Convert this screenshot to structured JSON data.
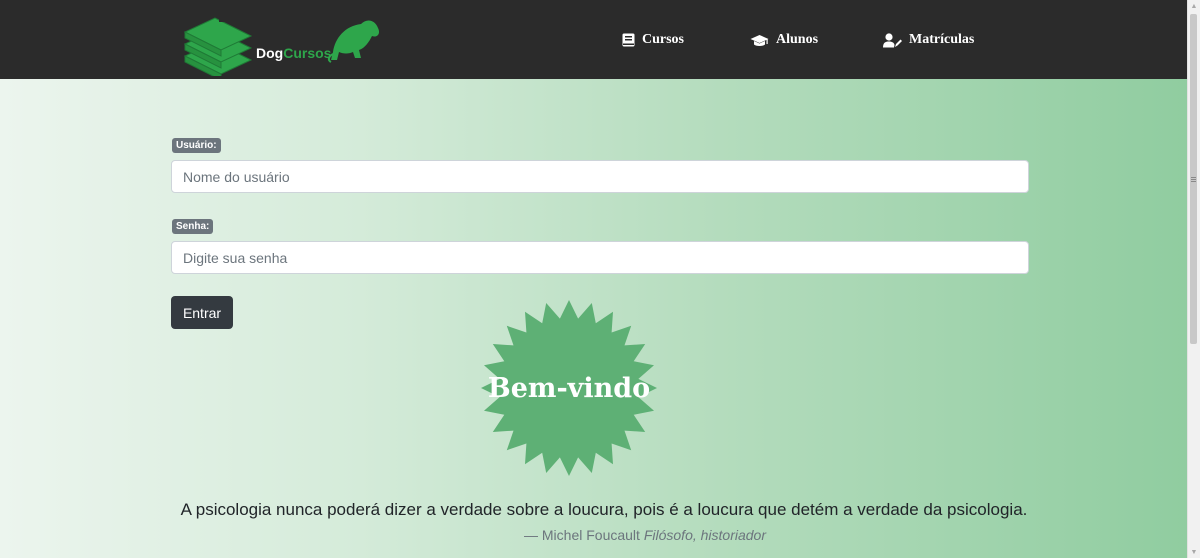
{
  "brand": {
    "name_part1": "Dog",
    "name_part2": "Cursos",
    "name_part3": ".",
    "accent_color": "#2ea64b"
  },
  "nav": {
    "items": [
      {
        "label": "Cursos",
        "icon": "book-icon"
      },
      {
        "label": "Alunos",
        "icon": "graduation-cap-icon"
      },
      {
        "label": "Matrículas",
        "icon": "user-edit-icon"
      }
    ]
  },
  "form": {
    "username_label": "Usuário:",
    "username_placeholder": "Nome do usuário",
    "password_label": "Senha:",
    "password_placeholder": "Digite sua senha",
    "submit_label": "Entrar"
  },
  "welcome": {
    "text": "Bem-vindo",
    "color": "#5eb075"
  },
  "quote": {
    "text": "A psicologia nunca poderá dizer a verdade sobre a loucura, pois é a loucura que detém a verdade da psicologia.",
    "author": "— Michel Foucault",
    "source": "Filósofo, historiador"
  }
}
